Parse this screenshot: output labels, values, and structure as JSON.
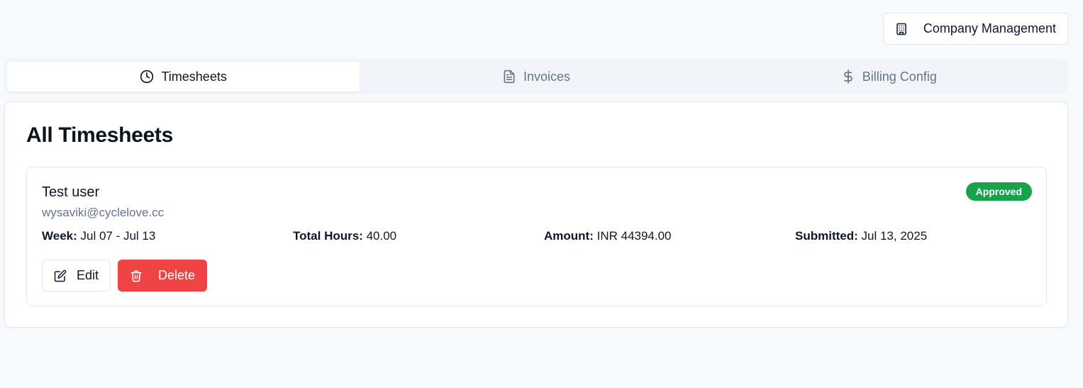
{
  "header": {
    "company_management_label": "Company Management"
  },
  "tabs": [
    {
      "label": "Timesheets",
      "icon": "clock-icon",
      "active": true
    },
    {
      "label": "Invoices",
      "icon": "file-text-icon",
      "active": false
    },
    {
      "label": "Billing Config",
      "icon": "dollar-sign-icon",
      "active": false
    }
  ],
  "main": {
    "title": "All Timesheets",
    "timesheets": [
      {
        "user_name": "Test user",
        "email": "wysaviki@cyclelove.cc",
        "status": "Approved",
        "week_label": "Week:",
        "week_value": "Jul 07 - Jul 13",
        "hours_label": "Total Hours:",
        "hours_value": "40.00",
        "amount_label": "Amount:",
        "amount_value": "INR 44394.00",
        "submitted_label": "Submitted:",
        "submitted_value": "Jul 13, 2025",
        "edit_label": "Edit",
        "delete_label": "Delete"
      }
    ]
  },
  "colors": {
    "approved": "#16a34a",
    "delete": "#ef4444",
    "muted_text": "#64748b"
  }
}
